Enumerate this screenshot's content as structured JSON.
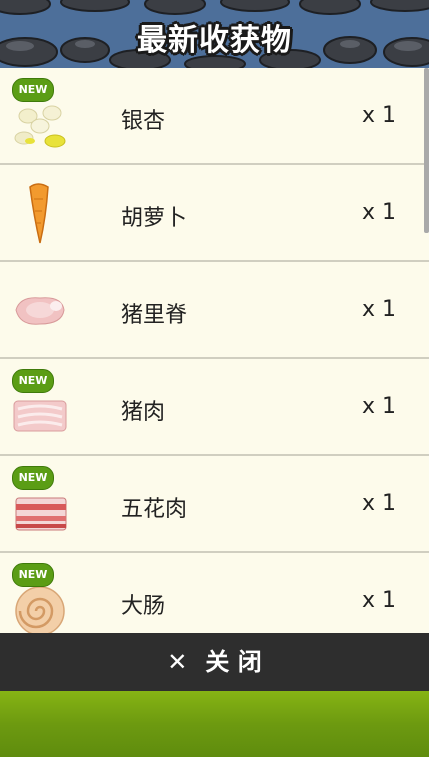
{
  "header": {
    "title": "最新收获物"
  },
  "items": [
    {
      "name": "银杏",
      "qty": "x 1",
      "is_new": true,
      "new_label": "NEW",
      "icon": "ginkgo-icon"
    },
    {
      "name": "胡萝卜",
      "qty": "x 1",
      "is_new": false,
      "new_label": "",
      "icon": "carrot-icon"
    },
    {
      "name": "猪里脊",
      "qty": "x 1",
      "is_new": false,
      "new_label": "",
      "icon": "pork-loin-icon"
    },
    {
      "name": "猪肉",
      "qty": "x 1",
      "is_new": true,
      "new_label": "NEW",
      "icon": "pork-icon"
    },
    {
      "name": "五花肉",
      "qty": "x 1",
      "is_new": true,
      "new_label": "NEW",
      "icon": "pork-belly-icon"
    },
    {
      "name": "大肠",
      "qty": "x 1",
      "is_new": true,
      "new_label": "NEW",
      "icon": "intestine-icon"
    }
  ],
  "close": {
    "label": "关 闭",
    "icon": "close-icon"
  }
}
